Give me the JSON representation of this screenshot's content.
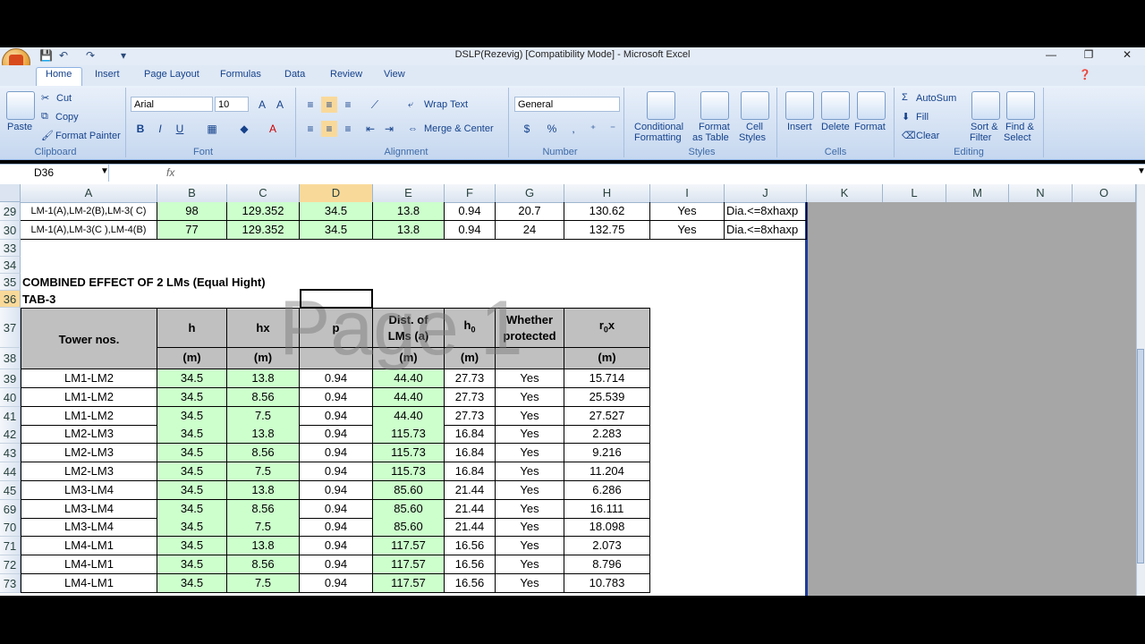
{
  "window": {
    "title": "DSLP(Rezevig)  [Compatibility Mode] - Microsoft Excel",
    "controls": [
      "—",
      "❐",
      "✕"
    ]
  },
  "ribbon": {
    "tabs": [
      "Home",
      "Insert",
      "Page Layout",
      "Formulas",
      "Data",
      "Review",
      "View"
    ],
    "clipboard": {
      "paste": "Paste",
      "cut": "Cut",
      "copy": "Copy",
      "format_painter": "Format Painter",
      "label": "Clipboard"
    },
    "font": {
      "name": "Arial",
      "size": "10",
      "label": "Font",
      "bold": "B",
      "italic": "I",
      "underline": "U"
    },
    "alignment": {
      "wrap": "Wrap Text",
      "merge": "Merge & Center",
      "label": "Alignment"
    },
    "number": {
      "format": "General",
      "label": "Number"
    },
    "styles": {
      "cond1": "Conditional",
      "cond2": "Formatting",
      "fmt1": "Format",
      "fmt2": "as Table",
      "cell1": "Cell",
      "cell2": "Styles",
      "label": "Styles"
    },
    "cells": {
      "insert": "Insert",
      "delete": "Delete",
      "format": "Format",
      "label": "Cells"
    },
    "editing": {
      "autosum": "AutoSum",
      "fill": "Fill",
      "clear": "Clear",
      "sort1": "Sort &",
      "sort2": "Filter",
      "find1": "Find &",
      "find2": "Select",
      "label": "Editing"
    }
  },
  "formula_bar": {
    "name_box": "D36",
    "fx": "fx",
    "value": ""
  },
  "columns": [
    "A",
    "B",
    "C",
    "D",
    "E",
    "F",
    "G",
    "H",
    "I",
    "J",
    "K",
    "L",
    "M",
    "N",
    "O"
  ],
  "top_rows": [
    {
      "row": "29",
      "cells": [
        "LM-1(A),LM-2(B),LM-3( C)",
        "98",
        "129.352",
        "34.5",
        "13.8",
        "0.94",
        "20.7",
        "130.62",
        "Yes",
        "Dia.<=8xhaxp"
      ]
    },
    {
      "row": "30",
      "cells": [
        "LM-1(A),LM-3(C ),LM-4(B)",
        "77",
        "129.352",
        "34.5",
        "13.8",
        "0.94",
        "24",
        "132.75",
        "Yes",
        "Dia.<=8xhaxp"
      ]
    }
  ],
  "empty_rows": [
    "33",
    "34"
  ],
  "section_title": {
    "row": "35",
    "text": "COMBINED EFFECT OF 2 LMs (Equal Hight)"
  },
  "tab_label": {
    "row": "36",
    "text": "TAB-3"
  },
  "header": {
    "row37": "37",
    "row38": "38",
    "tower": "Tower nos.",
    "h": "h",
    "hx": "hx",
    "p": "p",
    "dist1": "Dist. of",
    "dist2": "LMs (a)",
    "h0": "h",
    "h0_sub": "0",
    "wp1": "Whether",
    "wp2": "protected",
    "r0x_a": "r",
    "r0x_sub": "0",
    "r0x_b": "x",
    "unit": "(m)"
  },
  "rows": [
    {
      "row": "39",
      "cells": [
        "LM1-LM2",
        "34.5",
        "13.8",
        "0.94",
        "44.40",
        "27.73",
        "Yes",
        "15.714"
      ]
    },
    {
      "row": "40",
      "cells": [
        "LM1-LM2",
        "34.5",
        "8.56",
        "0.94",
        "44.40",
        "27.73",
        "Yes",
        "25.539"
      ]
    },
    {
      "row": "41",
      "cells": [
        "LM1-LM2",
        "34.5",
        "7.5",
        "0.94",
        "44.40",
        "27.73",
        "Yes",
        "27.527"
      ]
    },
    {
      "row": "42",
      "cells": [
        "LM2-LM3",
        "34.5",
        "13.8",
        "0.94",
        "115.73",
        "16.84",
        "Yes",
        "2.283"
      ]
    },
    {
      "row": "43",
      "cells": [
        "LM2-LM3",
        "34.5",
        "8.56",
        "0.94",
        "115.73",
        "16.84",
        "Yes",
        "9.216"
      ]
    },
    {
      "row": "44",
      "cells": [
        "LM2-LM3",
        "34.5",
        "7.5",
        "0.94",
        "115.73",
        "16.84",
        "Yes",
        "11.204"
      ]
    },
    {
      "row": "45",
      "cells": [
        "LM3-LM4",
        "34.5",
        "13.8",
        "0.94",
        "85.60",
        "21.44",
        "Yes",
        "6.286"
      ]
    },
    {
      "row": "69",
      "cells": [
        "LM3-LM4",
        "34.5",
        "8.56",
        "0.94",
        "85.60",
        "21.44",
        "Yes",
        "16.111"
      ]
    },
    {
      "row": "70",
      "cells": [
        "LM3-LM4",
        "34.5",
        "7.5",
        "0.94",
        "85.60",
        "21.44",
        "Yes",
        "18.098"
      ]
    },
    {
      "row": "71",
      "cells": [
        "LM4-LM1",
        "34.5",
        "13.8",
        "0.94",
        "117.57",
        "16.56",
        "Yes",
        "2.073"
      ]
    },
    {
      "row": "72",
      "cells": [
        "LM4-LM1",
        "34.5",
        "8.56",
        "0.94",
        "117.57",
        "16.56",
        "Yes",
        "8.796"
      ]
    },
    {
      "row": "73",
      "cells": [
        "LM4-LM1",
        "34.5",
        "7.5",
        "0.94",
        "117.57",
        "16.56",
        "Yes",
        "10.783"
      ]
    }
  ],
  "watermark": "Page 1",
  "colors": {
    "green_cell": "#ccffcc",
    "grey_header": "#c0c0c0",
    "selected_col": "#f9d99a"
  }
}
